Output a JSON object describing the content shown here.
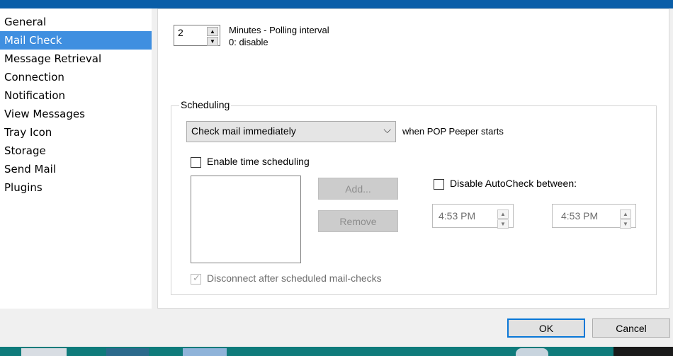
{
  "sidebar": {
    "items": [
      {
        "label": "General",
        "selected": false
      },
      {
        "label": "Mail Check",
        "selected": true
      },
      {
        "label": "Message Retrieval",
        "selected": false
      },
      {
        "label": "Connection",
        "selected": false
      },
      {
        "label": "Notification",
        "selected": false
      },
      {
        "label": "View Messages",
        "selected": false
      },
      {
        "label": "Tray Icon",
        "selected": false
      },
      {
        "label": "Storage",
        "selected": false
      },
      {
        "label": "Send Mail",
        "selected": false
      },
      {
        "label": "Plugins",
        "selected": false
      }
    ]
  },
  "polling": {
    "value": "2",
    "label_line1": "Minutes - Polling interval",
    "label_line2": "0: disable"
  },
  "scheduling": {
    "group_title": "Scheduling",
    "dropdown_value": "Check mail immediately",
    "dropdown_suffix": "when POP Peeper starts",
    "enable_time_scheduling": {
      "label": "Enable time scheduling",
      "checked": false
    },
    "add_label": "Add...",
    "remove_label": "Remove",
    "disable_autocheck": {
      "label": "Disable AutoCheck between:",
      "checked": false
    },
    "time_from": "4:53 PM",
    "time_to": "4:53 PM",
    "disconnect": {
      "label": "Disconnect after scheduled mail-checks",
      "checked": true,
      "enabled": false
    }
  },
  "dialog": {
    "ok_label": "OK",
    "cancel_label": "Cancel"
  },
  "colors": {
    "accent": "#0a5ea8",
    "selection": "#3f8fe0",
    "taskbar": "#0f7b7b"
  }
}
